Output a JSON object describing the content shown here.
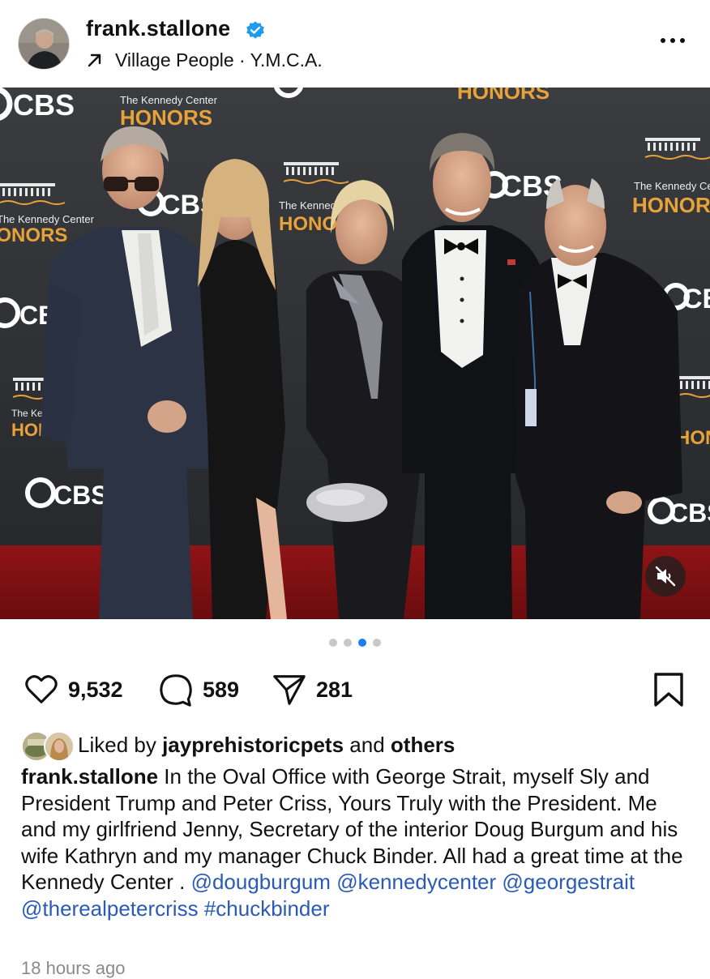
{
  "post": {
    "username": "frank.stallone",
    "audio": "Village People · Y.M.C.A.",
    "backdrop_texts": {
      "cbs": "CBS",
      "kc_small": "The Kennedy Center",
      "honors": "HONORS"
    },
    "carousel": {
      "total": 4,
      "active_index": 2
    },
    "likes_count": "9,532",
    "comments_count": "589",
    "shares_count": "281",
    "liked_by": {
      "prefix": "Liked by",
      "user": "jayprehistoricpets",
      "middle": "and",
      "suffix": "others"
    },
    "caption": {
      "user": "frank.stallone",
      "text": " In the Oval Office with George Strait, myself Sly and President Trump and Peter Criss, Yours Truly with the President. Me and my girlfriend Jenny, Secretary of the interior Doug Burgum and his wife Kathryn and my manager Chuck Binder. All had a great time at the Kennedy Center . ",
      "tags": [
        "@dougburgum",
        "@kennedycenter",
        "@georgestrait",
        "@therealpetercriss",
        "#chuckbinder"
      ]
    },
    "timestamp": "18 hours ago"
  },
  "icons": {
    "verified": "verified-badge-icon",
    "audio": "arrow-up-right-icon",
    "more": "more-horizontal-icon",
    "mute": "speaker-muted-icon",
    "like": "heart-icon",
    "comment": "comment-bubble-icon",
    "share": "paper-plane-icon",
    "save": "bookmark-icon"
  },
  "colors": {
    "verified_blue": "#1d9bf0",
    "active_dot": "#1d7cf2",
    "link_blue": "#2a5ab8",
    "honors_gold": "#e8a23a",
    "carpet_red": "#8f1416"
  }
}
